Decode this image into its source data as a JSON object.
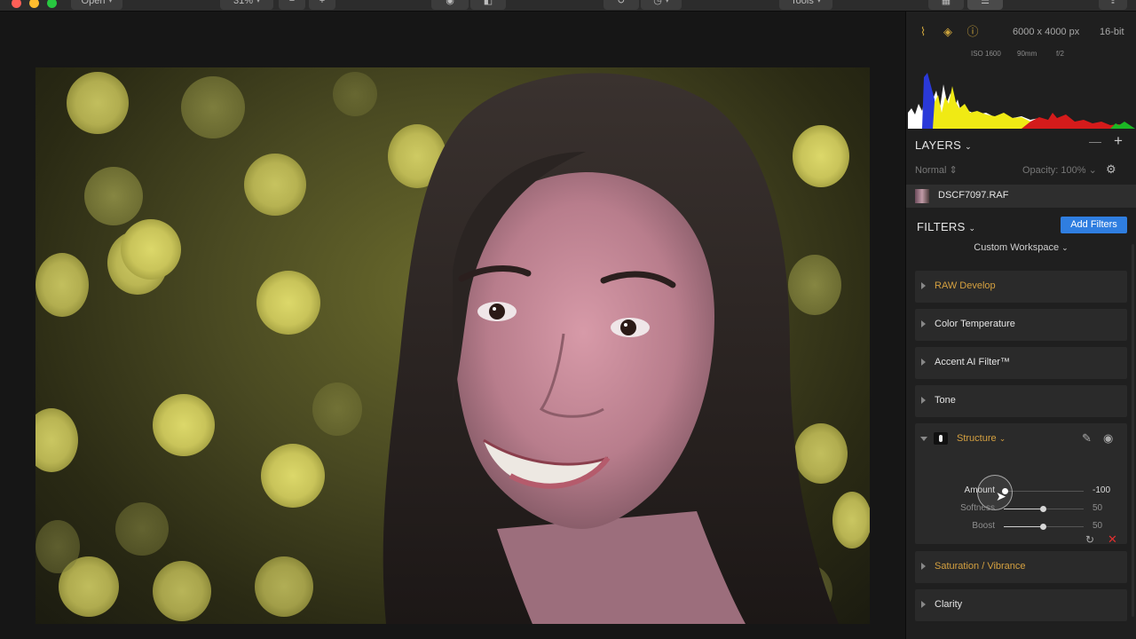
{
  "toolbar": {
    "open_label": "Open",
    "zoom_label": "31%",
    "tools_label": "Tools"
  },
  "info": {
    "dimensions": "6000 x 4000 px",
    "bit_depth": "16-bit",
    "iso": "ISO 1600",
    "focal": "90mm",
    "aperture": "f/2"
  },
  "layers": {
    "title": "LAYERS",
    "blend_mode": "Normal",
    "opacity_label": "Opacity:",
    "opacity_value": "100%",
    "layer_name": "DSCF7097.RAF"
  },
  "filters": {
    "title": "FILTERS",
    "add_button": "Add Filters",
    "workspace": "Custom Workspace",
    "items": [
      {
        "label": "RAW Develop"
      },
      {
        "label": "Color Temperature"
      },
      {
        "label": "Accent AI Filter™"
      },
      {
        "label": "Tone"
      },
      {
        "label": "Structure"
      },
      {
        "label": "Saturation / Vibrance"
      },
      {
        "label": "Clarity"
      }
    ],
    "structure_sliders": [
      {
        "label": "Amount",
        "value": "-100",
        "fraction": 0.0
      },
      {
        "label": "Softness",
        "value": "50",
        "fraction": 0.5
      },
      {
        "label": "Boost",
        "value": "50",
        "fraction": 0.5
      }
    ]
  },
  "colors": {
    "accent_blue": "#2f7ee0",
    "orange": "#d4a040",
    "panel_bg": "#1f1f1f",
    "card_bg": "#2a2a2a"
  }
}
